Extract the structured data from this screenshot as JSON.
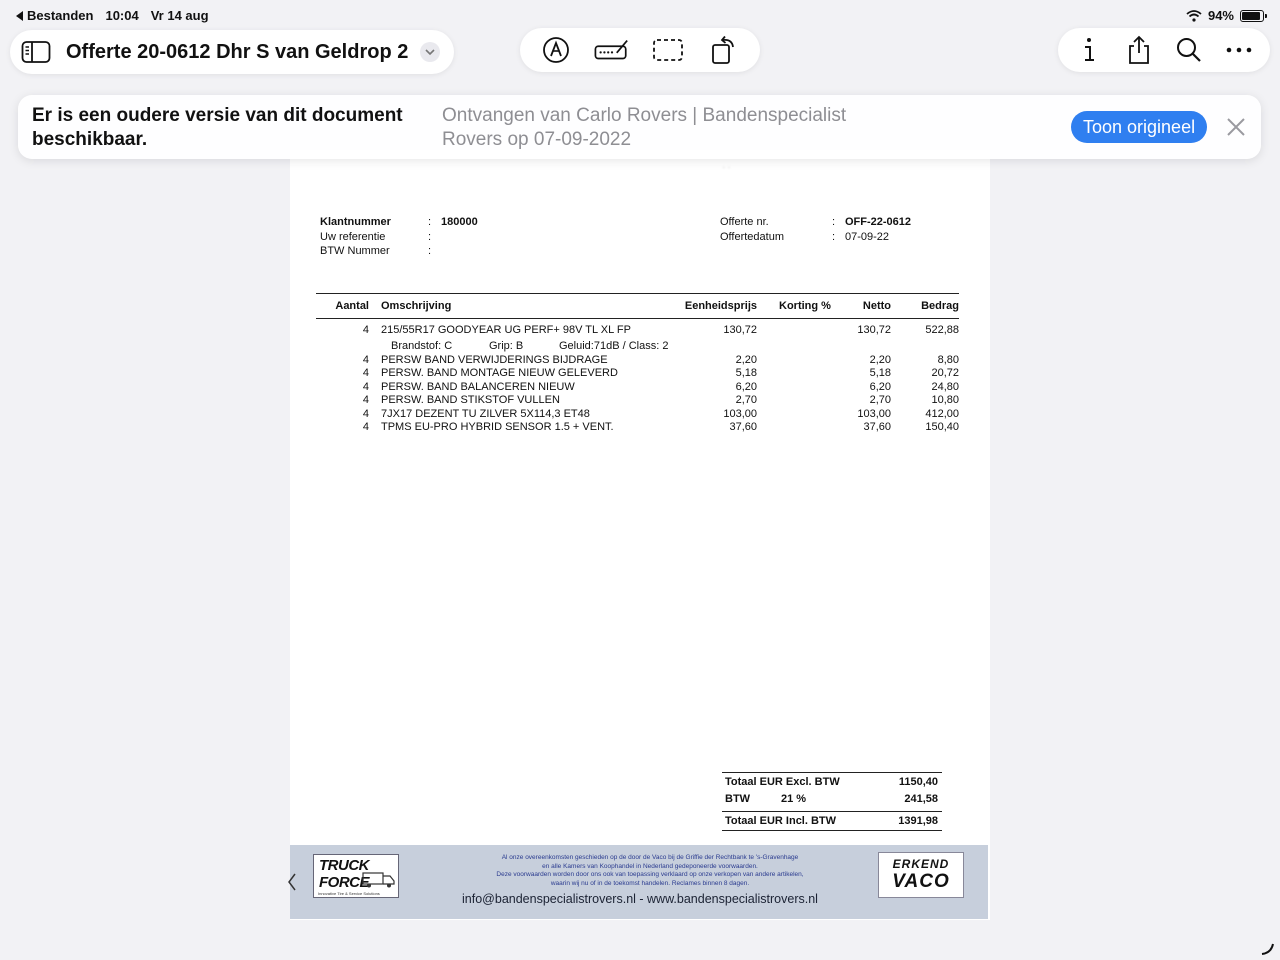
{
  "status_bar": {
    "back_app": "Bestanden",
    "time": "10:04",
    "date": "Vr 14 aug",
    "battery": "94%"
  },
  "toolbar": {
    "title": "Offerte 20-0612 Dhr S van Geldrop 2",
    "left_icons": [
      "sidebar-icon",
      "chevron-down-icon"
    ],
    "center_icons": [
      "markup-pen-icon",
      "signature-icon",
      "selection-icon",
      "rotate-icon"
    ],
    "right_icons": [
      "info-icon",
      "share-icon",
      "search-icon",
      "more-icon"
    ]
  },
  "banner": {
    "message": "Er is een oudere versie van dit document beschikbaar.",
    "source": "Ontvangen van Carlo Rovers | Bandenspecialist Rovers op 07-09-2022",
    "button": "Toon origineel"
  },
  "document": {
    "customer": [
      {
        "label": "Klantnummer",
        "value": "180000"
      },
      {
        "label": "Uw referentie",
        "value": ""
      },
      {
        "label": "BTW Nummer",
        "value": ""
      }
    ],
    "quote": [
      {
        "label": "Offerte nr.",
        "value": "OFF-22-0612"
      },
      {
        "label": "Offertedatum",
        "value": "07-09-22"
      }
    ],
    "columns": {
      "aantal": "Aantal",
      "omschrijving": "Omschrijving",
      "eenheidsprijs": "Eenheidsprijs",
      "korting": "Korting %",
      "netto": "Netto",
      "bedrag": "Bedrag"
    },
    "lines": [
      {
        "aantal": "4",
        "omschrijving": "215/55R17 GOODYEAR UG PERF+ 98V TL XL FP",
        "eenheidsprijs": "130,72",
        "korting": "",
        "netto": "130,72",
        "bedrag": "522,88"
      },
      {
        "aantal": "4",
        "omschrijving": "PERSW BAND VERWIJDERINGS BIJDRAGE",
        "eenheidsprijs": "2,20",
        "korting": "",
        "netto": "2,20",
        "bedrag": "8,80"
      },
      {
        "aantal": "4",
        "omschrijving": "PERSW. BAND MONTAGE NIEUW GELEVERD",
        "eenheidsprijs": "5,18",
        "korting": "",
        "netto": "5,18",
        "bedrag": "20,72"
      },
      {
        "aantal": "4",
        "omschrijving": "PERSW. BAND BALANCEREN NIEUW",
        "eenheidsprijs": "6,20",
        "korting": "",
        "netto": "6,20",
        "bedrag": "24,80"
      },
      {
        "aantal": "4",
        "omschrijving": "PERSW. BAND STIKSTOF VULLEN",
        "eenheidsprijs": "2,70",
        "korting": "",
        "netto": "2,70",
        "bedrag": "10,80"
      },
      {
        "aantal": "4",
        "omschrijving": "7JX17 DEZENT TU ZILVER 5X114,3 ET48",
        "eenheidsprijs": "103,00",
        "korting": "",
        "netto": "103,00",
        "bedrag": "412,00"
      },
      {
        "aantal": "4",
        "omschrijving": "TPMS EU-PRO HYBRID SENSOR 1.5 + VENT.",
        "eenheidsprijs": "37,60",
        "korting": "",
        "netto": "37,60",
        "bedrag": "150,40"
      }
    ],
    "tyre_label": {
      "brandstof": "Brandstof: C",
      "grip": "Grip: B",
      "geluid": "Geluid:71dB / Class: 2"
    },
    "totals": {
      "excl_label": "Totaal EUR Excl. BTW",
      "excl_value": "1150,40",
      "btw_label": "BTW",
      "btw_rate": "21 %",
      "btw_value": "241,58",
      "incl_label": "Totaal EUR Incl. BTW",
      "incl_value": "1391,98"
    },
    "footer": {
      "truck_logo": "TRUCK FORCE",
      "truck_tagline": "Innovative Tire & Service Solutions",
      "vaco_top": "ERKEND",
      "vaco_bottom": "VACO",
      "legal_1": "Al onze overeenkomsten geschieden op de door de Vaco bij de Griffie der Rechtbank te 's-Gravenhage",
      "legal_2": "en alle Kamers van Koophandel in Nederland gedeponeerde voorwaarden.",
      "legal_3": "Deze voorwaarden worden door ons ook van toepassing verklaard op onze verkopen van andere artikelen,",
      "legal_4": "waarin wij nu of in de toekomst handelen. Reclames binnen 8 dagen.",
      "contact": "info@bandenspecialistrovers.nl  -  www.bandenspecialistrovers.nl"
    }
  }
}
